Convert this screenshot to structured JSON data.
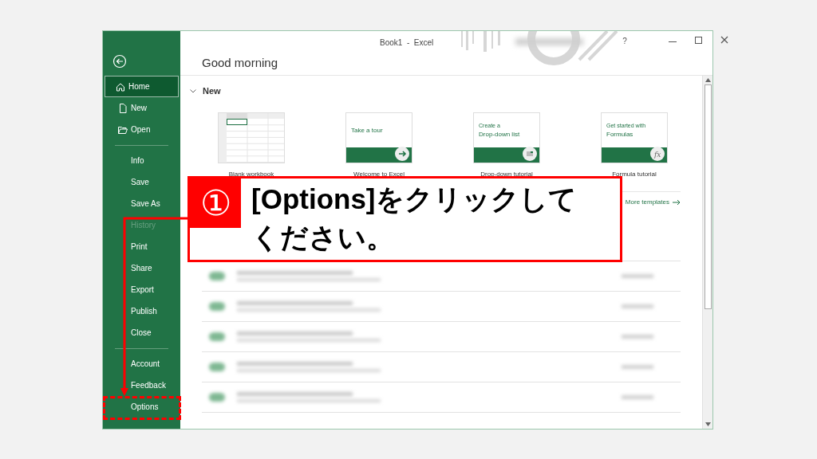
{
  "window": {
    "title": "Book1  -  Excel",
    "help": "?"
  },
  "sidebar": {
    "groups": [
      [
        {
          "label": "Home",
          "kind": "home",
          "selected": true,
          "disabled": false
        },
        {
          "label": "New",
          "kind": "file",
          "selected": false,
          "disabled": false
        },
        {
          "label": "Open",
          "kind": "folder",
          "selected": false,
          "disabled": false
        }
      ],
      [
        {
          "label": "Info",
          "selected": false,
          "disabled": false
        },
        {
          "label": "Save",
          "selected": false,
          "disabled": false
        },
        {
          "label": "Save As",
          "selected": false,
          "disabled": false
        },
        {
          "label": "History",
          "selected": false,
          "disabled": true
        },
        {
          "label": "Print",
          "selected": false,
          "disabled": false
        },
        {
          "label": "Share",
          "selected": false,
          "disabled": false
        },
        {
          "label": "Export",
          "selected": false,
          "disabled": false
        },
        {
          "label": "Publish",
          "selected": false,
          "disabled": false
        },
        {
          "label": "Close",
          "selected": false,
          "disabled": false
        }
      ],
      [
        {
          "label": "Account",
          "selected": false,
          "disabled": false
        },
        {
          "label": "Feedback",
          "selected": false,
          "disabled": false
        },
        {
          "label": "Options",
          "selected": false,
          "disabled": false
        }
      ]
    ]
  },
  "greeting": "Good morning",
  "new_section": {
    "heading": "New",
    "templates": [
      {
        "kind": "blank",
        "label": "Blank workbook"
      },
      {
        "kind": "tour",
        "label": "Welcome to Excel",
        "caption": "Take a tour"
      },
      {
        "kind": "list",
        "label": "Drop-down tutorial",
        "subcaption": "Create a",
        "caption": "Drop-down list"
      },
      {
        "kind": "formula",
        "label": "Formula tutorial",
        "subcaption": "Get started with",
        "caption": "Formulas",
        "badge": "fx"
      }
    ],
    "more": "More templates"
  },
  "callout": {
    "number": "①",
    "text": "[Options]をクリックしてください。"
  }
}
